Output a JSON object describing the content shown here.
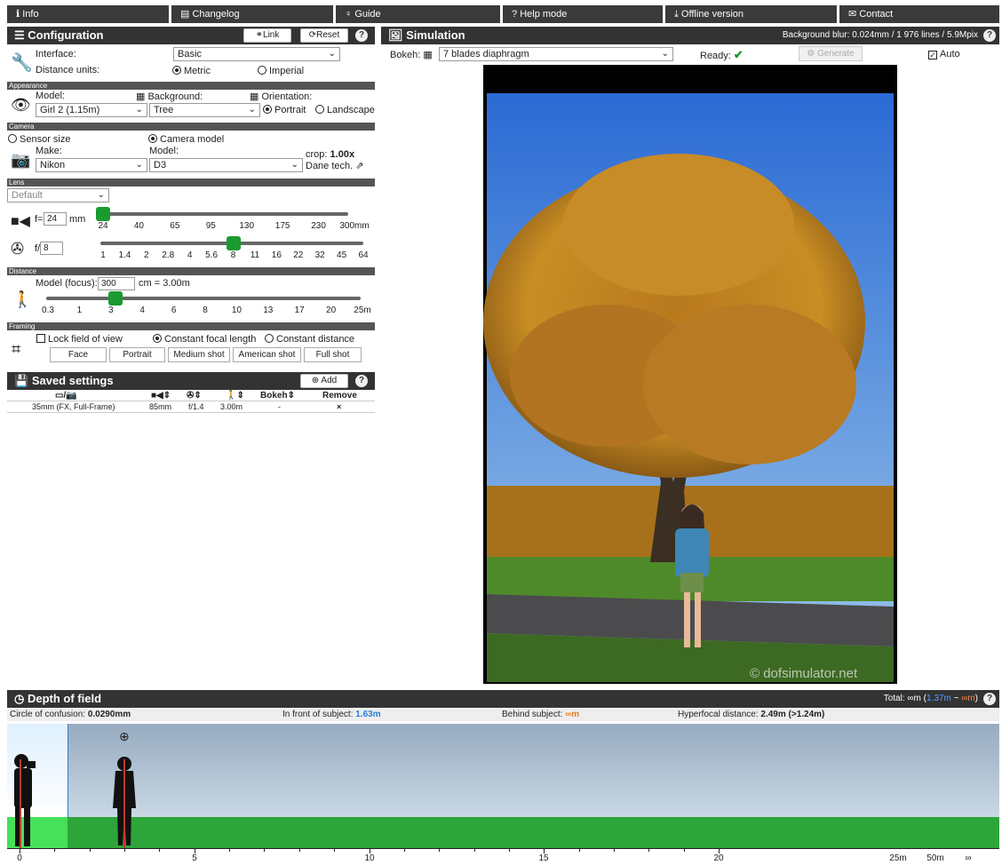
{
  "nav": {
    "info": "Info",
    "changelog": "Changelog",
    "guide": "Guide",
    "help_mode": "Help mode",
    "offline": "Offline version",
    "contact": "Contact"
  },
  "config": {
    "title": "Configuration",
    "link": "Link",
    "reset": "Reset",
    "interface_label": "Interface:",
    "interface_value": "Basic",
    "units_label": "Distance units:",
    "metric": "Metric",
    "imperial": "Imperial"
  },
  "appearance": {
    "title": "Appearance",
    "model_label": "Model:",
    "model_value": "Girl 2 (1.15m)",
    "background_label": "Background:",
    "background_value": "Tree",
    "orientation_label": "Orientation:",
    "portrait": "Portrait",
    "landscape": "Landscape"
  },
  "camera": {
    "title": "Camera",
    "sensor_size": "Sensor size",
    "camera_model": "Camera model",
    "make_label": "Make:",
    "make_value": "Nikon",
    "model_label": "Model:",
    "model_value": "D3",
    "crop_label": "crop:",
    "crop_value": "1.00x",
    "dane": "Dane tech."
  },
  "lens": {
    "title": "Lens",
    "preset": "Default",
    "focal_prefix": "f=",
    "focal_value": "24",
    "focal_unit": "mm",
    "focal_ticks": [
      "24",
      "40",
      "65",
      "95",
      "130",
      "175",
      "230",
      "300mm"
    ],
    "aperture_prefix": "f/",
    "aperture_value": "8",
    "aperture_ticks": [
      "1",
      "1.4",
      "2",
      "2.8",
      "4",
      "5.6",
      "8",
      "11",
      "16",
      "22",
      "32",
      "45",
      "64"
    ],
    "focal_position": 0.0,
    "aperture_position": 0.5
  },
  "distance": {
    "title": "Distance",
    "label": "Model (focus):",
    "value": "300",
    "unit_text": "cm = 3.00m",
    "ticks": [
      "0.3",
      "1",
      "3",
      "4",
      "6",
      "8",
      "10",
      "13",
      "17",
      "20",
      "25m"
    ],
    "position": 0.22
  },
  "framing": {
    "title": "Framing",
    "lock_fov": "Lock field of view",
    "constant_focal": "Constant focal length",
    "constant_distance": "Constant distance",
    "buttons": [
      "Face",
      "Portrait",
      "Medium shot",
      "American shot",
      "Full shot"
    ]
  },
  "saved": {
    "title": "Saved settings",
    "add": "Add",
    "bokeh_col": "Bokeh",
    "remove_col": "Remove",
    "rows": [
      {
        "camera": "35mm (FX, Full-Frame)",
        "focal": "85mm",
        "aperture": "f/1.4",
        "distance": "3.00m",
        "bokeh": "-",
        "remove": "×"
      }
    ]
  },
  "simulation": {
    "title": "Simulation",
    "blur": "Background blur: 0.024mm / 1 976 lines / 5.9Mpix",
    "bokeh_label": "Bokeh:",
    "bokeh_value": "7 blades diaphragm",
    "ready": "Ready:",
    "generate": "Generate",
    "auto": "Auto",
    "watermark": "© dofsimulator.net"
  },
  "dof": {
    "title": "Depth of field",
    "total_label": "Total:",
    "total_inf": "∞m",
    "near": "1.37m",
    "sep": "~",
    "far": "∞m",
    "coc_label": "Circle of confusion:",
    "coc_value": "0.0290mm",
    "front_label": "In front of subject:",
    "front_value": "1.63m",
    "behind_label": "Behind subject:",
    "behind_value": "∞m",
    "hyper_label": "Hyperfocal distance:",
    "hyper_value": "2.49m (>1.24m)",
    "ruler": [
      "0",
      "5",
      "10",
      "15",
      "20",
      "25m",
      "50m",
      "∞"
    ]
  },
  "colors": {
    "accent_green": "#1a9b2f",
    "header": "#333333",
    "near_blue": "#2b7bd6",
    "far_orange": "#e67e22"
  }
}
